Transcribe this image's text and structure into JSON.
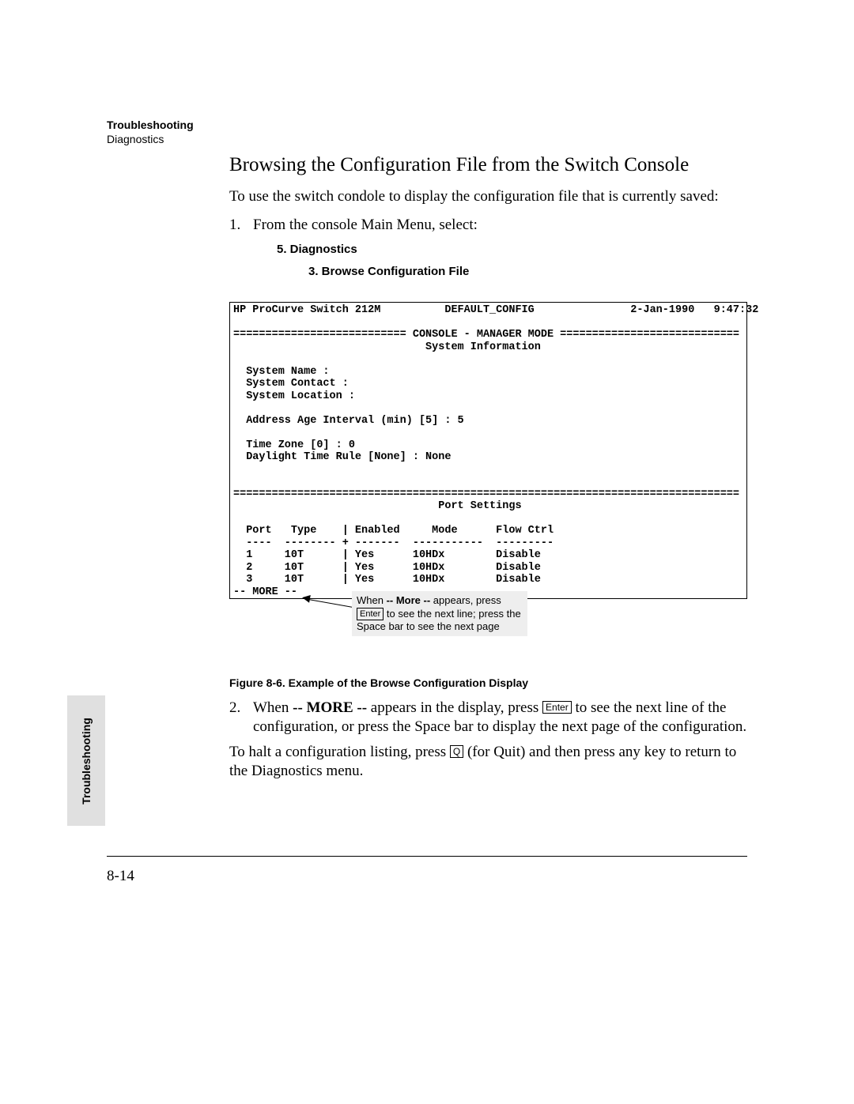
{
  "header": {
    "line1": "Troubleshooting",
    "line2": "Diagnostics"
  },
  "section_title": "Browsing the Configuration File from the Switch Console",
  "intro": "To use the switch condole to display the configuration file that is currently saved:",
  "step1_num": "1.",
  "step1_text": "From the console Main Menu, select:",
  "menu1": "5. Diagnostics",
  "menu2": "3. Browse Configuration File",
  "console": {
    "line01": "HP ProCurve Switch 212M          DEFAULT_CONFIG               2-Jan-1990   9:47:32",
    "line02": "",
    "line03": "=========================== CONSOLE - MANAGER MODE ============================",
    "line04": "                              System Information",
    "line05": "",
    "line06": "  System Name :",
    "line07": "  System Contact :",
    "line08": "  System Location :",
    "line09": "",
    "line10": "  Address Age Interval (min) [5] : 5",
    "line11": "",
    "line12": "  Time Zone [0] : 0",
    "line13": "  Daylight Time Rule [None] : None",
    "line14": "",
    "line15": "",
    "line16": "===============================================================================",
    "line17": "                                Port Settings",
    "line18": "",
    "line19": "  Port   Type    | Enabled     Mode      Flow Ctrl",
    "line20": "  ----  -------- + -------  -----------  ---------",
    "line21": "  1     10T      | Yes      10HDx        Disable",
    "line22": "  2     10T      | Yes      10HDx        Disable",
    "line23": "  3     10T      | Yes      10HDx        Disable",
    "line24": "-- MORE --"
  },
  "callout": {
    "prefix": "When ",
    "bold": "-- More --",
    "mid1": " appears, press ",
    "key": "Enter",
    "mid2": " to see the next line; press the Space bar to see the next page"
  },
  "figure_caption": "Figure 8-6.   Example of the Browse Configuration Display",
  "step2_num": "2.",
  "step2_prefix": "When ",
  "step2_bold": "-- MORE --",
  "step2_mid1": " appears in the display, press ",
  "step2_key": "Enter",
  "step2_suffix": " to see the next line of the configuration, or press the Space bar to display the next page of the configuration.",
  "halt_prefix": "To halt a configuration listing, press ",
  "halt_key": "Q",
  "halt_suffix": " (for Quit) and then press any key to return to the Diagnostics menu.",
  "side_tab": "Troubleshooting",
  "page_number": "8-14"
}
